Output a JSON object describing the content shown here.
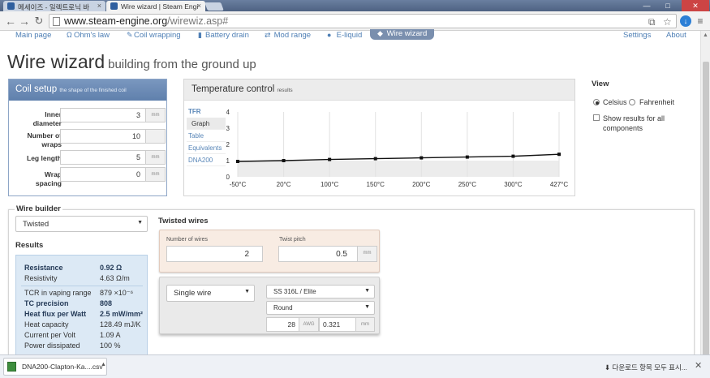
{
  "browser": {
    "tabs": [
      {
        "title": "메세이즈 - 일렉트로닉 바",
        "active": false,
        "color": "#3a6fb0"
      },
      {
        "title": "Wire wizard | Steam Engi",
        "active": true,
        "color": "#3a6fb0"
      }
    ],
    "url_host": "www.steam-engine.org",
    "url_path": "/wirewiz.asp#"
  },
  "nav": {
    "items": [
      {
        "label": "Main page",
        "icon": ""
      },
      {
        "label": "Ohm's law",
        "icon": "omega-icon"
      },
      {
        "label": "Coil wrapping",
        "icon": "coil-icon"
      },
      {
        "label": "Battery drain",
        "icon": "battery-icon"
      },
      {
        "label": "Mod range",
        "icon": "arrows-icon"
      },
      {
        "label": "E-liquid",
        "icon": "drop-icon"
      },
      {
        "label": "Wire wizard",
        "icon": "wand-icon"
      }
    ],
    "settings": "Settings",
    "about": "About"
  },
  "page": {
    "title": "Wire wizard",
    "subtitle": "building from the ground up"
  },
  "coil_setup": {
    "title": "Coil setup",
    "subtitle": "the shape of the finished coil",
    "fields": [
      {
        "label1": "Inner",
        "label2": "diameter",
        "value": "3",
        "unit": "mm"
      },
      {
        "label1": "Number of",
        "label2": "wraps",
        "value": "10",
        "unit": ""
      },
      {
        "label1": "Leg length",
        "label2": "",
        "value": "5",
        "unit": "mm"
      },
      {
        "label1": "Wrap",
        "label2": "spacing",
        "value": "0",
        "unit": "mm"
      }
    ]
  },
  "temp_control": {
    "title": "Temperature control",
    "subtitle": "results",
    "tabs": {
      "head": "TFR",
      "items": [
        "Graph",
        "Table",
        "Equivalents",
        "DNA200"
      ]
    }
  },
  "chart_data": {
    "type": "line",
    "categories": [
      "-50°C",
      "20°C",
      "100°C",
      "150°C",
      "200°C",
      "250°C",
      "300°C",
      "427°C"
    ],
    "series": [
      {
        "values": [
          0.95,
          1.0,
          1.07,
          1.12,
          1.17,
          1.22,
          1.27,
          1.39
        ]
      }
    ],
    "yticks": [
      "0",
      "1",
      "2",
      "3",
      "4"
    ],
    "ylim": [
      0,
      4
    ],
    "title": "",
    "xlabel": "",
    "ylabel": "",
    "grid": true
  },
  "view": {
    "title": "View",
    "celsius": "Celsius",
    "fahrenheit": "Fahrenheit",
    "show_all": "Show results for all components"
  },
  "wire_builder": {
    "title": "Wire builder",
    "type_select": "Twisted",
    "results_title": "Results",
    "results": [
      {
        "label": "Resistance",
        "value": "0.92 Ω",
        "bold": true
      },
      {
        "label": "Resistivity",
        "value": "4.63 Ω/m",
        "bold": false
      },
      {
        "label": "TCR in vaping range",
        "value": "879 ×10⁻⁶",
        "bold": false
      },
      {
        "label": "TC precision",
        "value": "808",
        "bold": true
      },
      {
        "label": "Heat flux per Watt",
        "value": "2.5 mW/mm²",
        "bold": true
      },
      {
        "label": "Heat capacity",
        "value": "128.49 mJ/K",
        "bold": false
      },
      {
        "label": "Current per Volt",
        "value": "1.09 A",
        "bold": false
      },
      {
        "label": "Power dissipated",
        "value": "100 %",
        "bold": false
      }
    ],
    "twisted": {
      "title": "Twisted wires",
      "num_wires_label": "Number of wires",
      "num_wires": "2",
      "pitch_label": "Twist pitch",
      "pitch": "0.5",
      "pitch_unit": "mm"
    },
    "single": {
      "kind": "Single wire",
      "material": "SS 316L / Elite",
      "shape": "Round",
      "awg": "28",
      "awg_unit": "AWG",
      "diameter": "0.321",
      "diameter_unit": "mm"
    }
  },
  "downloads": {
    "file": "DNA200-Clapton-Ka....csv",
    "show_all": "다운로드 항목 모두 표시..."
  }
}
